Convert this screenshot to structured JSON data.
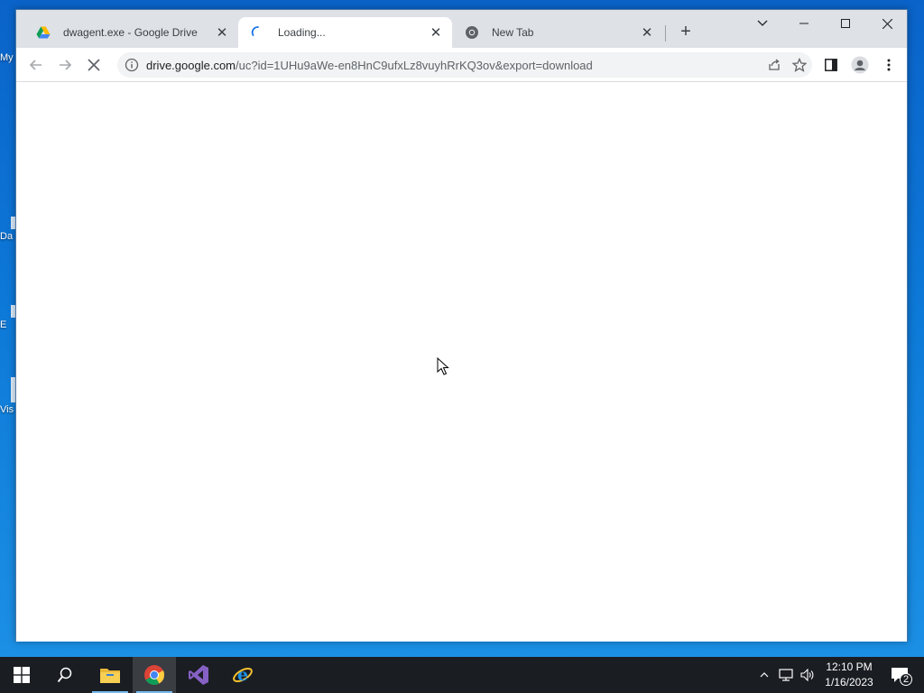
{
  "desktop": {
    "fragments": [
      "My",
      "Da",
      "E",
      "Vis"
    ]
  },
  "browser": {
    "tabs": [
      {
        "title": "dwagent.exe - Google Drive",
        "icon": "google-drive-icon"
      },
      {
        "title": "Loading...",
        "icon": "loading-spinner-icon"
      },
      {
        "title": "New Tab",
        "icon": "chrome-icon"
      }
    ],
    "url": {
      "host": "drive.google.com",
      "path": "/uc?id=1UHu9aWe-en8HnC9ufxLz8vuyhRrKQ3ov&export=download"
    }
  },
  "taskbar": {
    "time": "12:10 PM",
    "date": "1/16/2023",
    "notifications": "2",
    "apps": [
      "start-icon",
      "search-icon",
      "file-explorer-icon",
      "chrome-icon",
      "visual-studio-icon",
      "internet-explorer-icon"
    ]
  },
  "colors": {
    "desktop": "#0d79d8",
    "tabstrip": "#dee1e6",
    "taskbar": "#1a1d22"
  }
}
